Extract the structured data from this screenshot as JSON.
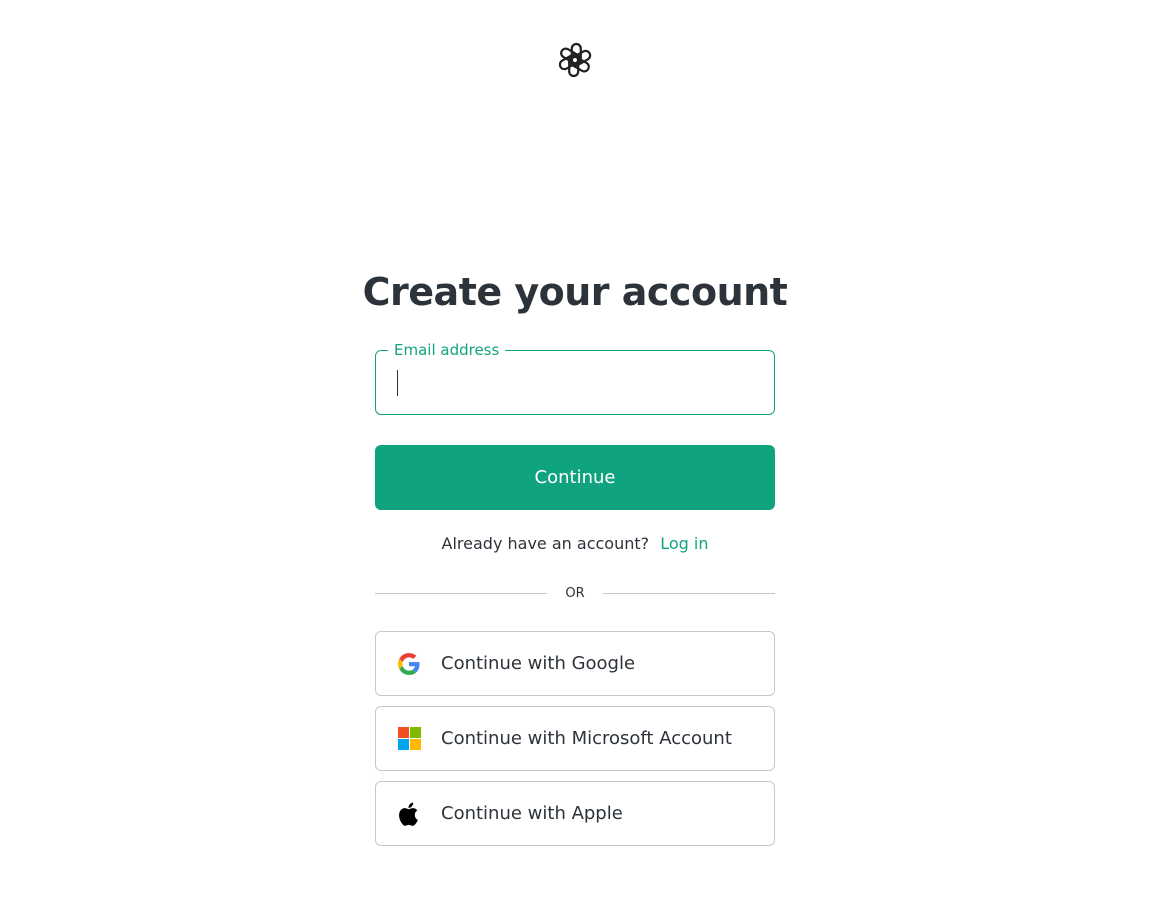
{
  "brand": {
    "logo_icon": "openai-logo-icon",
    "accent_color": "#10a37f"
  },
  "page": {
    "title": "Create your account"
  },
  "email_field": {
    "label": "Email address",
    "value": "",
    "placeholder": ""
  },
  "continue_button": {
    "label": "Continue"
  },
  "login_prompt": {
    "text": "Already have an account?",
    "link": "Log in"
  },
  "divider": {
    "text": "OR"
  },
  "social_buttons": [
    {
      "label": "Continue with Google",
      "icon": "google-icon"
    },
    {
      "label": "Continue with Microsoft Account",
      "icon": "microsoft-icon"
    },
    {
      "label": "Continue with Apple",
      "icon": "apple-icon"
    }
  ]
}
